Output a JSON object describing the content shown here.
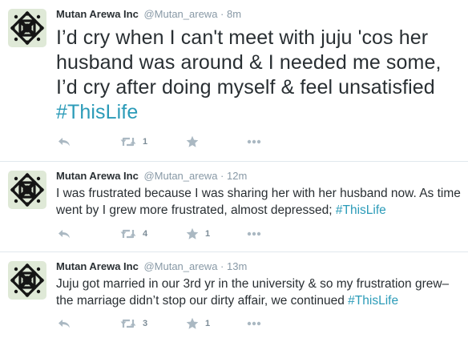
{
  "tweets": [
    {
      "author": "Mutan Arewa Inc",
      "handle": "@Mutan_arewa",
      "separator": "·",
      "time": "8m",
      "text": "I’d cry when I can't meet with juju 'cos her husband was around & I needed me some, I’d cry after doing myself & feel unsatisfied ",
      "hashtag": "#ThisLife",
      "retweets": "1",
      "favorites": ""
    },
    {
      "author": "Mutan Arewa Inc",
      "handle": "@Mutan_arewa",
      "separator": "·",
      "time": "12m",
      "text": "I was frustrated because I was sharing her with her husband now. As time went by I grew more frustrated, almost depressed; ",
      "hashtag": "#ThisLife",
      "retweets": "4",
      "favorites": "1"
    },
    {
      "author": "Mutan Arewa Inc",
      "handle": "@Mutan_arewa",
      "separator": "·",
      "time": "13m",
      "text": "Juju got married in our 3rd yr in the university & so my frustration grew– the marriage didn’t stop our dirty affair, we continued ",
      "hashtag": "#ThisLife",
      "retweets": "3",
      "favorites": "1"
    }
  ],
  "icons": {
    "avatar": "celtic-knot-logo",
    "reply": "reply-arrow-icon",
    "retweet": "retweet-icon",
    "favorite": "star-icon",
    "more": "ellipsis-icon"
  },
  "colors": {
    "text": "#292f33",
    "muted": "#8899a6",
    "hashtag": "#2b9bb8",
    "icon": "#aab8c2",
    "avatar_bg": "#dfe9d7",
    "divider": "#e1e8ed"
  }
}
